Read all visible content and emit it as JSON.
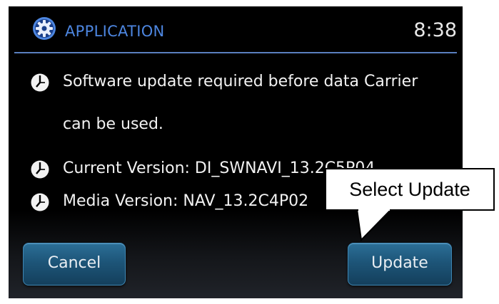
{
  "header": {
    "icon": "gear-icon",
    "title": "APPLICATION",
    "time": "8:38"
  },
  "messages": [
    {
      "icon": "clock-bullet-icon",
      "text": "Software update required before data Carrier"
    },
    {
      "icon": null,
      "text": "can be used."
    },
    {
      "icon": "clock-bullet-icon",
      "text": "Current Version: DI_SWNAVI_13.2C5P04"
    },
    {
      "icon": "clock-bullet-icon",
      "text": "Media Version: NAV_13.2C4P02"
    }
  ],
  "buttons": {
    "cancel_label": "Cancel",
    "update_label": "Update"
  },
  "callout": {
    "text": "Select Update"
  },
  "colors": {
    "accent_blue": "#4d86e0",
    "button_blue": "#1d5578",
    "background": "#000000"
  }
}
